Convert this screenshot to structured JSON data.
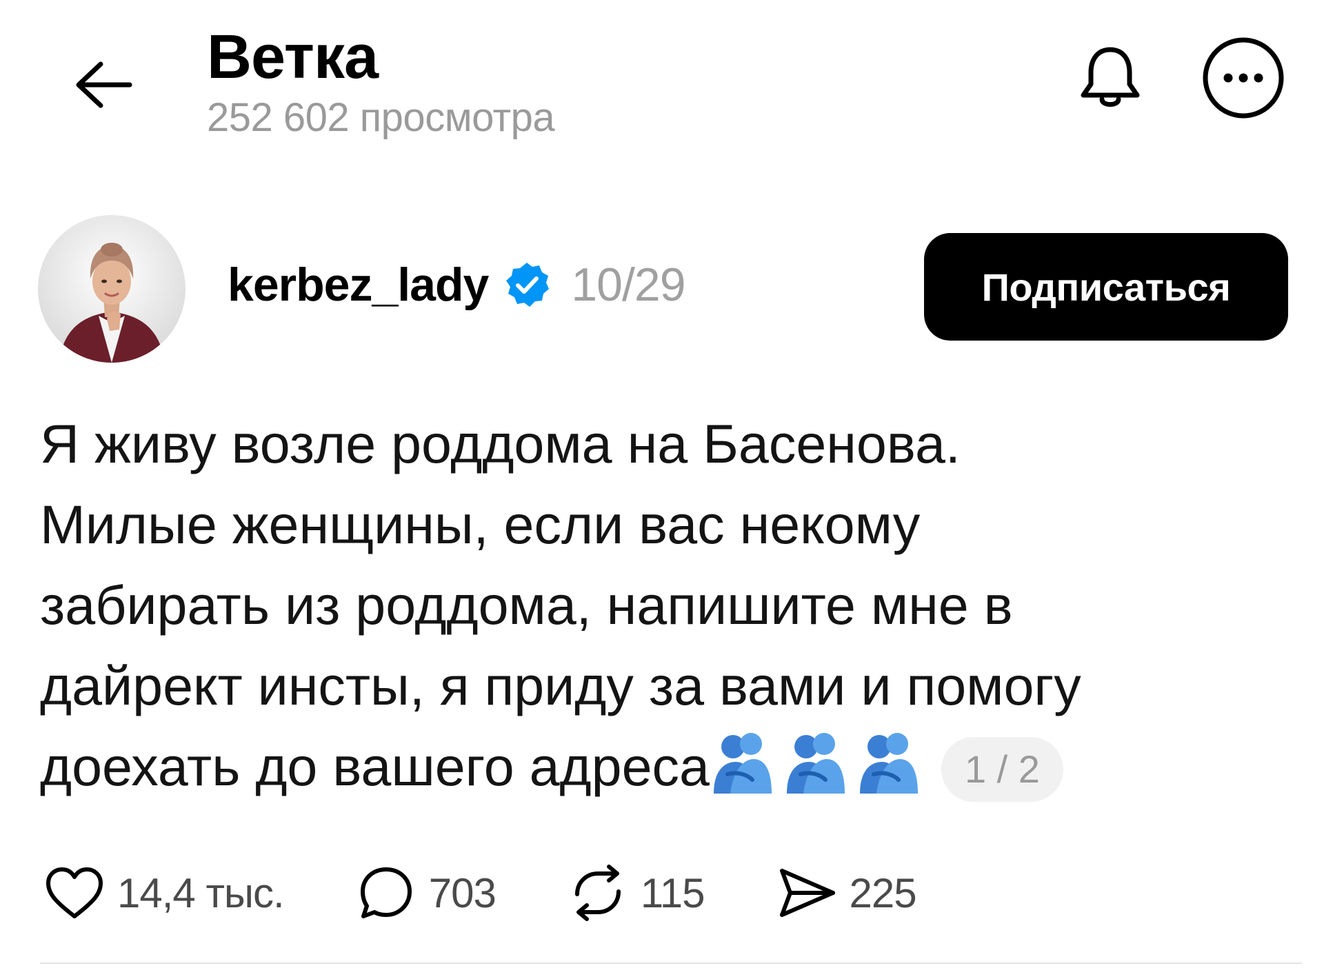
{
  "header": {
    "title": "Ветка",
    "views": "252 602 просмотра",
    "back_icon": "arrow-left-icon",
    "bell_icon": "bell-icon",
    "more_icon": "more-horizontal-icon"
  },
  "post": {
    "author": {
      "username": "kerbez_lady",
      "verified": true,
      "verified_color": "#0095f6"
    },
    "date": "10/29",
    "follow_label": "Подписаться",
    "text_lines": [
      "Я живу возле роддома на Басенова.",
      "Милые женщины, если вас некому",
      "забирать из роддома, напишите мне в",
      "дайрект инсты, я приду за вами и помогу",
      "доехать до вашего адреса"
    ],
    "emoji": "people-hugging-emoji",
    "emoji_count": 3,
    "page_indicator": "1 / 2",
    "actions": {
      "likes": "14,4 тыс.",
      "comments": "703",
      "reposts": "115",
      "shares": "225"
    }
  }
}
